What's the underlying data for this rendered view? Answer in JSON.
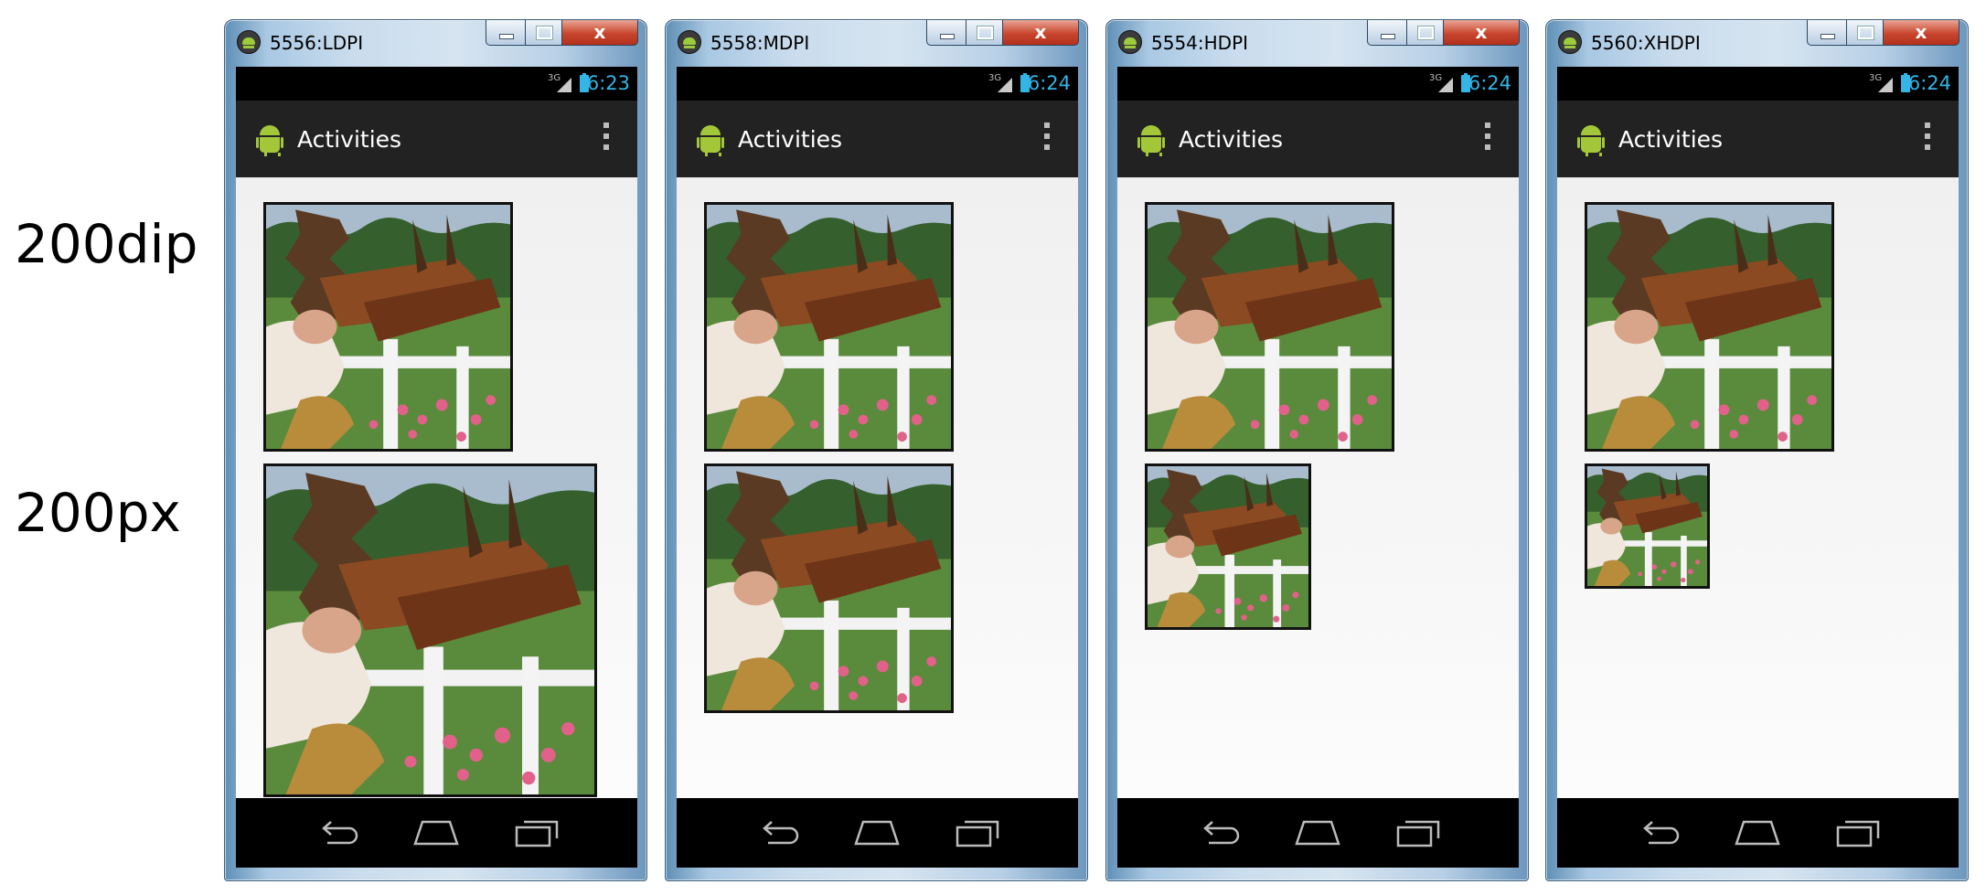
{
  "row_labels": {
    "dip": "200dip",
    "px": "200px"
  },
  "emulators": [
    {
      "title": "5556:LDPI",
      "time": "6:23",
      "network": "3G",
      "app_title": "Activities"
    },
    {
      "title": "5558:MDPI",
      "time": "6:24",
      "network": "3G",
      "app_title": "Activities"
    },
    {
      "title": "5554:HDPI",
      "time": "6:24",
      "network": "3G",
      "app_title": "Activities"
    },
    {
      "title": "5560:XHDPI",
      "time": "6:24",
      "network": "3G",
      "app_title": "Activities"
    }
  ],
  "window_controls": {
    "close_glyph": "x"
  },
  "colors": {
    "status_accent": "#33b5e5",
    "android_green": "#a4c639",
    "actionbar": "#222222",
    "close_button": "#c9452e"
  }
}
